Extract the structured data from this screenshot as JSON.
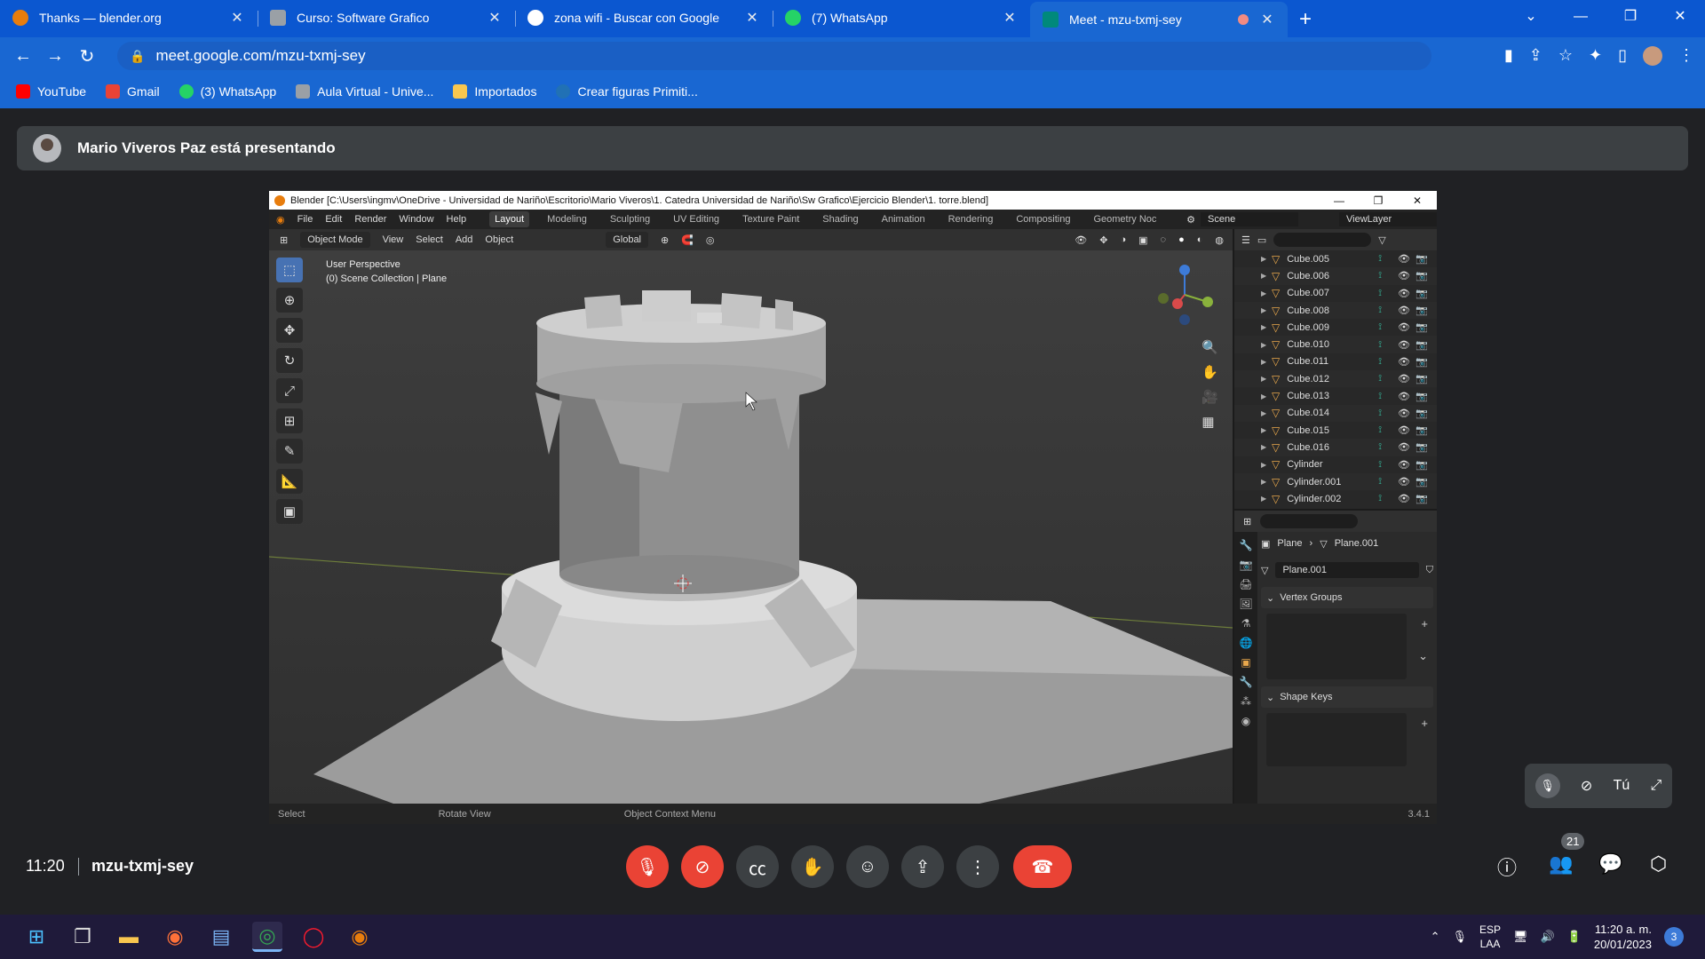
{
  "browser": {
    "tabs": [
      {
        "title": "Thanks — blender.org",
        "color": "#e87d0d"
      },
      {
        "title": "Curso: Software Grafico",
        "color": "#9aa0a6"
      },
      {
        "title": "zona wifi - Buscar con Google",
        "color": "#ffffff"
      },
      {
        "title": "(7) WhatsApp",
        "color": "#25d366"
      },
      {
        "title": "Meet - mzu-txmj-sey",
        "color": "#00897b"
      }
    ],
    "url": "meet.google.com/mzu-txmj-sey",
    "bookmarks": [
      {
        "label": "YouTube",
        "color": "#ff0000"
      },
      {
        "label": "Gmail",
        "color": "#ea4335"
      },
      {
        "label": "(3) WhatsApp",
        "color": "#25d366"
      },
      {
        "label": "Aula Virtual - Unive...",
        "color": "#9aa0a6"
      },
      {
        "label": "Importados",
        "color": "#f9c74f"
      },
      {
        "label": "Crear figuras Primiti...",
        "color": "#2171b5"
      }
    ]
  },
  "meet": {
    "presenter_text": "Mario Viveros Paz está presentando",
    "time": "11:20",
    "meeting_code": "mzu-txmj-sey",
    "participants_count": "21",
    "self_label": "Tú"
  },
  "blender": {
    "title": "Blender [C:\\Users\\ingmv\\OneDrive - Universidad de Nariño\\Escritorio\\Mario Viveros\\1. Catedra Universidad de Nariño\\Sw Grafico\\Ejercicio Blender\\1. torre.blend]",
    "menus": [
      "File",
      "Edit",
      "Render",
      "Window",
      "Help"
    ],
    "workspaces": [
      "Layout",
      "Modeling",
      "Sculpting",
      "UV Editing",
      "Texture Paint",
      "Shading",
      "Animation",
      "Rendering",
      "Compositing",
      "Geometry Noc"
    ],
    "active_workspace": "Layout",
    "scene": "Scene",
    "view_layer": "ViewLayer",
    "mode": "Object Mode",
    "header_menus": [
      "View",
      "Select",
      "Add",
      "Object"
    ],
    "transform": "Global",
    "viewport_info_1": "User Perspective",
    "viewport_info_2": "(0) Scene Collection | Plane",
    "outliner_items": [
      "Cube.005",
      "Cube.006",
      "Cube.007",
      "Cube.008",
      "Cube.009",
      "Cube.010",
      "Cube.011",
      "Cube.012",
      "Cube.013",
      "Cube.014",
      "Cube.015",
      "Cube.016",
      "Cylinder",
      "Cylinder.001",
      "Cylinder.002"
    ],
    "props": {
      "object": "Plane",
      "mesh": "Plane.001",
      "vertex_groups": "Vertex Groups",
      "shape_keys": "Shape Keys"
    },
    "status": [
      "Select",
      "Rotate View",
      "Object Context Menu"
    ],
    "version": "3.4.1"
  },
  "taskbar": {
    "lang1": "ESP",
    "lang2": "LAA",
    "time": "11:20 a. m.",
    "date": "20/01/2023",
    "notifications": "3"
  }
}
